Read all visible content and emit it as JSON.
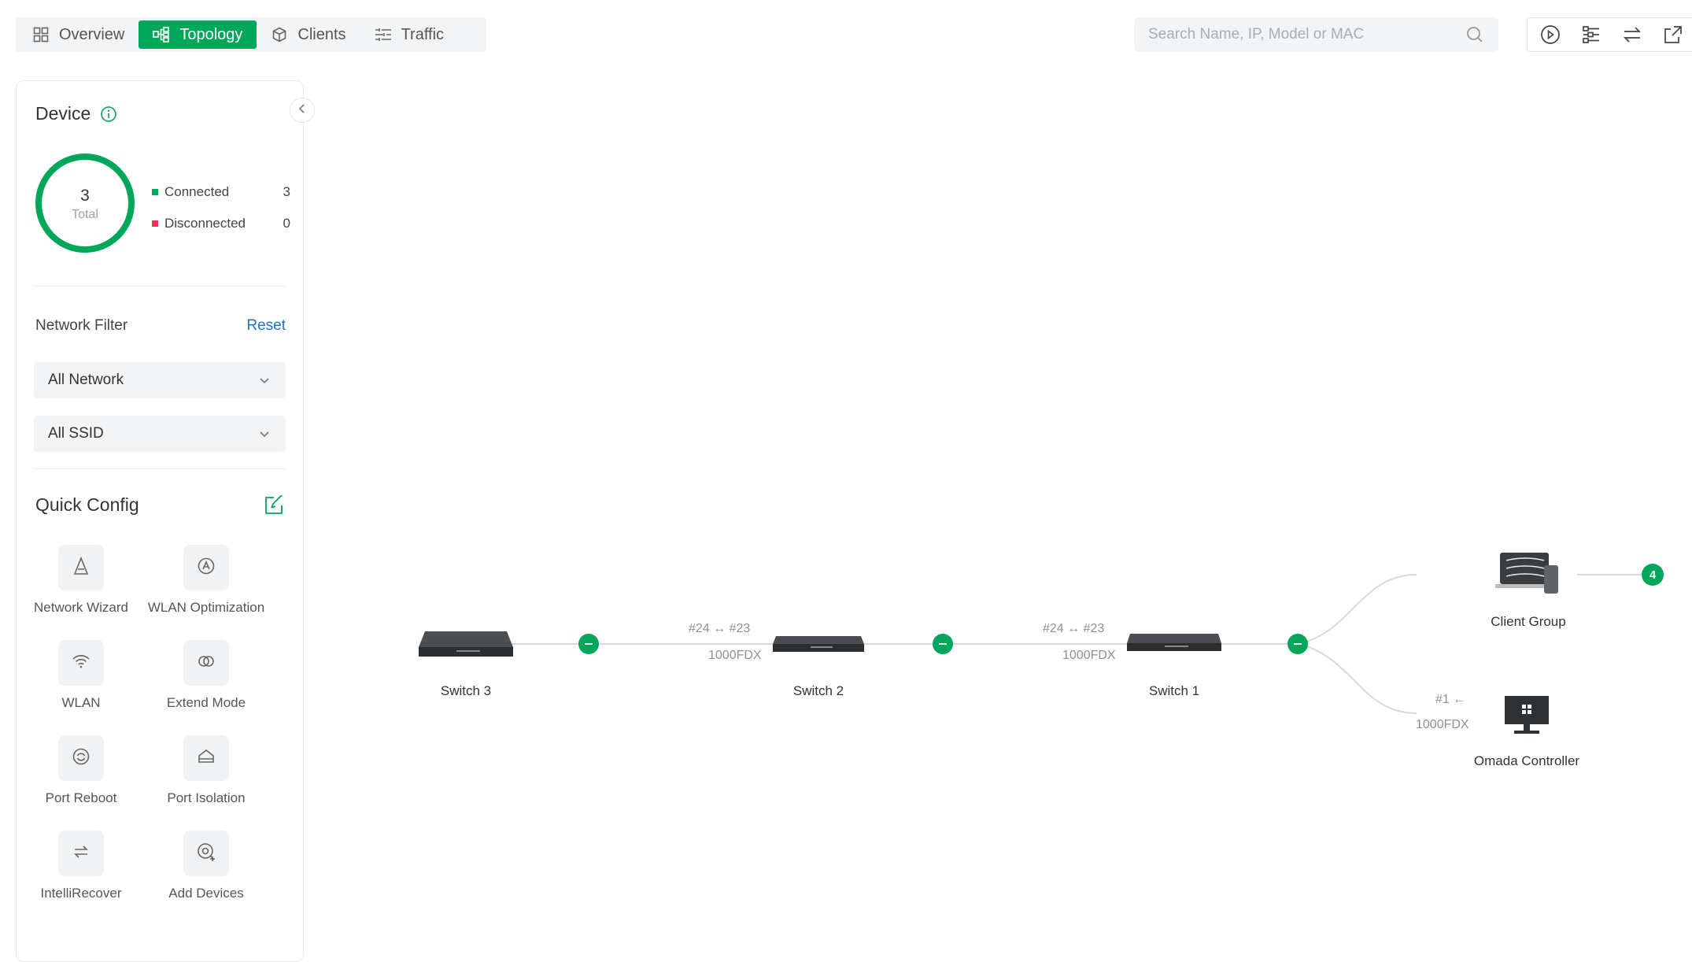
{
  "tabs": [
    {
      "label": "Overview",
      "icon": "grid-icon",
      "active": false
    },
    {
      "label": "Topology",
      "icon": "topology-icon",
      "active": true
    },
    {
      "label": "Clients",
      "icon": "cube-icon",
      "active": false
    },
    {
      "label": "Traffic",
      "icon": "traffic-icon",
      "active": false
    }
  ],
  "search": {
    "placeholder": "Search Name, IP, Model or MAC"
  },
  "toolbar": [
    "play-icon",
    "settings-sliders-icon",
    "swap-arrows-icon",
    "external-link-icon"
  ],
  "device_panel": {
    "title": "Device",
    "total": "3",
    "total_label": "Total",
    "legend": [
      {
        "label": "Connected",
        "value": "3",
        "color": "#00a65a"
      },
      {
        "label": "Disconnected",
        "value": "0",
        "color": "#e8344e"
      }
    ]
  },
  "network_filter": {
    "title": "Network Filter",
    "reset": "Reset",
    "network_select": "All Network",
    "ssid_select": "All SSID"
  },
  "quick_config": {
    "title": "Quick Config",
    "items": [
      {
        "label": "Network Wizard",
        "icon": "wizard-icon"
      },
      {
        "label": "WLAN Optimization",
        "icon": "wlan-optimization-icon"
      },
      {
        "label": "WLAN",
        "icon": "wifi-icon"
      },
      {
        "label": "Extend Mode",
        "icon": "extend-mode-icon"
      },
      {
        "label": "Port Reboot",
        "icon": "port-reboot-icon"
      },
      {
        "label": "Port Isolation",
        "icon": "port-isolation-icon"
      },
      {
        "label": "IntelliRecover",
        "icon": "recover-icon"
      },
      {
        "label": "Add Devices",
        "icon": "add-devices-icon"
      }
    ]
  },
  "topology": {
    "nodes": [
      {
        "name": "Switch 3"
      },
      {
        "name": "Switch 2"
      },
      {
        "name": "Switch 1"
      },
      {
        "name": "Client Group",
        "count": "4"
      },
      {
        "name": "Omada Controller"
      }
    ],
    "links": [
      {
        "ports": "#24 ↔ #23",
        "speed": "1000FDX"
      },
      {
        "ports": "#24 ↔ #23",
        "speed": "1000FDX"
      },
      {
        "ports": "#1 ←",
        "speed": "1000FDX"
      }
    ]
  },
  "colors": {
    "accent": "#00a65a",
    "link": "#1e72c6",
    "danger": "#e8344e"
  }
}
